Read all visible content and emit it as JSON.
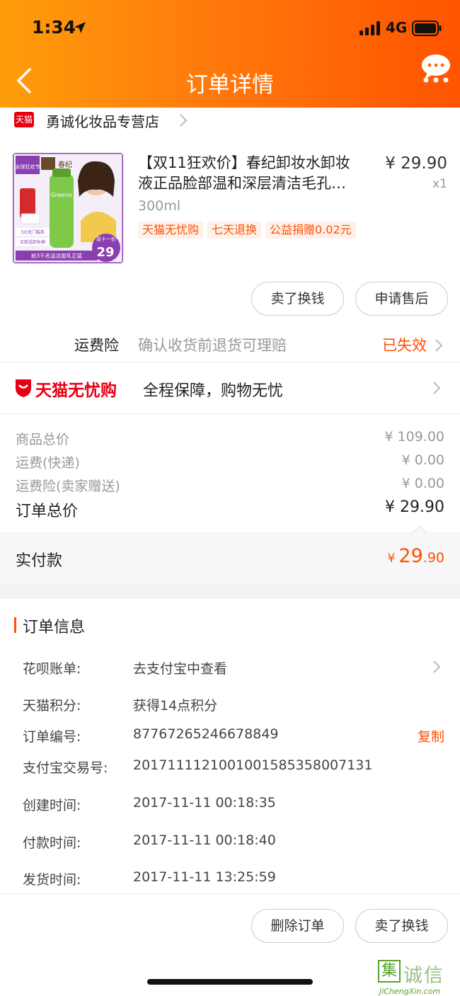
{
  "status_bar": {
    "time": "1:34",
    "network": "4G"
  },
  "nav": {
    "title": "订单详情"
  },
  "store": {
    "badge": "天猫",
    "name": "勇诚化妆品专营店"
  },
  "product": {
    "title_line1": "【双11狂欢价】春纪卸妆水卸妆",
    "title_line2": "液正品脸部温和深层清洁毛孔…",
    "spec": "300ml",
    "price": "¥ 29.90",
    "qty": "x1",
    "tags": [
      "天猫无忧购",
      "七天退换",
      "公益捐赠0.02元"
    ],
    "image": {
      "badge_top": "全球狂欢节",
      "brand": "春纪",
      "bottle_label": "Greenis",
      "promo_1": "3元无门槛券",
      "promo_2": "买就送卸妆棉",
      "promo_3": "前3千名送洁面乳正装",
      "price_tag_top": "双十一价",
      "price_tag_num": "29"
    }
  },
  "actions_top": {
    "sell": "卖了换钱",
    "after_sale": "申请售后"
  },
  "insurance": {
    "label": "运费险",
    "desc": "确认收货前退货可理赔",
    "status": "已失效"
  },
  "worry_free": {
    "brand": "天猫无忧购",
    "text": "全程保障，购物无忧"
  },
  "costs": [
    {
      "label": "商品总价",
      "value": "¥ 109.00"
    },
    {
      "label": "运费(快递)",
      "value": "¥ 0.00"
    },
    {
      "label": "运费险(卖家赠送)",
      "value": "¥ 0.00"
    }
  ],
  "order_total": {
    "label": "订单总价",
    "value": "¥ 29.90"
  },
  "payment": {
    "label": "实付款",
    "currency": "¥",
    "int": "29",
    "dec": ".90"
  },
  "order_info": {
    "title": "订单信息",
    "rows": [
      {
        "label": "花呗账单:",
        "value": "去支付宝中查看"
      },
      {
        "label": "天猫积分:",
        "value": "获得14点积分"
      },
      {
        "label": "订单编号:",
        "value": "87767265246678849",
        "action": "复制"
      },
      {
        "label": "支付宝交易号:",
        "value": "2017111121001001585358007131"
      },
      {
        "label": "创建时间:",
        "value": "2017-11-11 00:18:35"
      },
      {
        "label": "付款时间:",
        "value": "2017-11-11 00:18:40"
      },
      {
        "label": "发货时间:",
        "value": "2017-11-11 13:25:59"
      }
    ]
  },
  "actions_bottom": {
    "delete": "删除订单",
    "sell": "卖了换钱"
  },
  "watermark": {
    "mark": "集",
    "cn": "诚信",
    "en": "JiChengXin.com"
  },
  "colors": {
    "accent": "#ff5000",
    "tmall_red": "#e60012",
    "header_start": "#ff9d0b",
    "header_end": "#ff5400"
  }
}
